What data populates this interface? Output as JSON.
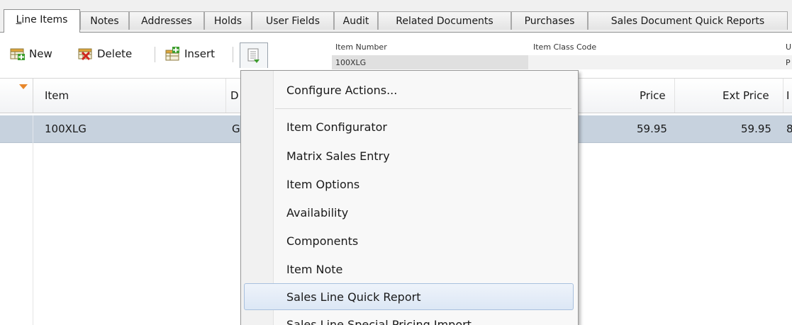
{
  "tabs": [
    {
      "label_first": "L",
      "label_rest": "ine Items"
    },
    {
      "label": "Notes"
    },
    {
      "label": "Addresses"
    },
    {
      "label": "Holds"
    },
    {
      "label": "User Fields"
    },
    {
      "label": "Audit"
    },
    {
      "label": "Related Documents"
    },
    {
      "label": "Purchases"
    },
    {
      "label": "Sales Document Quick Reports"
    }
  ],
  "toolbar": {
    "new_label": "New",
    "delete_label": "Delete",
    "insert_label": "Insert"
  },
  "info": {
    "item_number_label": "Item Number",
    "item_number_value": "100XLG",
    "item_class_label": "Item Class Code",
    "cut_label": "U",
    "cut_value": "P"
  },
  "grid": {
    "headers": {
      "item": "Item",
      "desc": "D",
      "price": "Price",
      "ext_price": "Ext Price",
      "extra": "I"
    },
    "rows": [
      {
        "item": "100XLG",
        "desc": "G",
        "price": "59.95",
        "ext_price": "59.95",
        "extra": "8"
      }
    ]
  },
  "menu": {
    "items": [
      "Configure Actions...",
      "Item Configurator",
      "Matrix Sales Entry",
      "Item Options",
      "Availability",
      "Components",
      "Item Note",
      "Sales Line Quick Report",
      "Sales Line Special Pricing Import"
    ]
  },
  "colors": {
    "selected_row": "#c7d2de",
    "menu_highlight": "#dce7f5",
    "sort_indicator": "#e8872b"
  }
}
